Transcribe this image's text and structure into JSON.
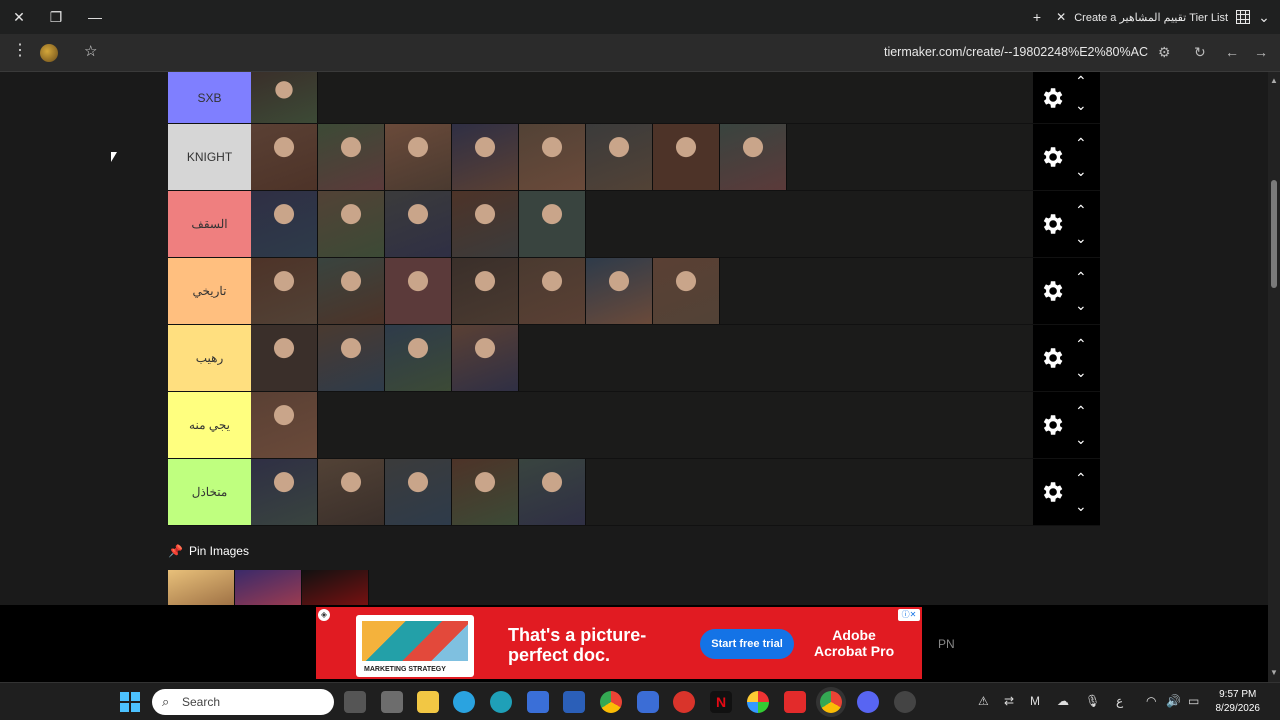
{
  "browser": {
    "tab_title": "Create a تقييم المشاهير Tier List",
    "url": "tiermaker.com/create/--19802248%E2%80%AC"
  },
  "tiers": [
    {
      "label": "SXB",
      "color": "#7f7fff",
      "image_count": 1
    },
    {
      "label": "KNIGHT",
      "color": "#d6d6d6",
      "image_count": 8
    },
    {
      "label": "السقف",
      "color": "#ef7f7f",
      "image_count": 5
    },
    {
      "label": "تاريخي",
      "color": "#ffbf7f",
      "image_count": 7
    },
    {
      "label": "رهيب",
      "color": "#ffdf7f",
      "image_count": 4
    },
    {
      "label": "يجي منه",
      "color": "#ffff7f",
      "image_count": 1
    },
    {
      "label": "متخاذل",
      "color": "#bfff7f",
      "image_count": 5
    }
  ],
  "pin_images": {
    "label": "Pin Images",
    "image_count": 3
  },
  "ad": {
    "headline_line1": "That's a picture-",
    "headline_line2": "perfect doc.",
    "cta": "Start free trial",
    "brand_line1": "Adobe",
    "brand_line2": "Acrobat Pro",
    "thumb_caption": "MARKETING STRATEGY",
    "side_text": "PN"
  },
  "taskbar": {
    "search_placeholder": "Search",
    "time": "9:57 PM",
    "date": "8/29/2026"
  }
}
